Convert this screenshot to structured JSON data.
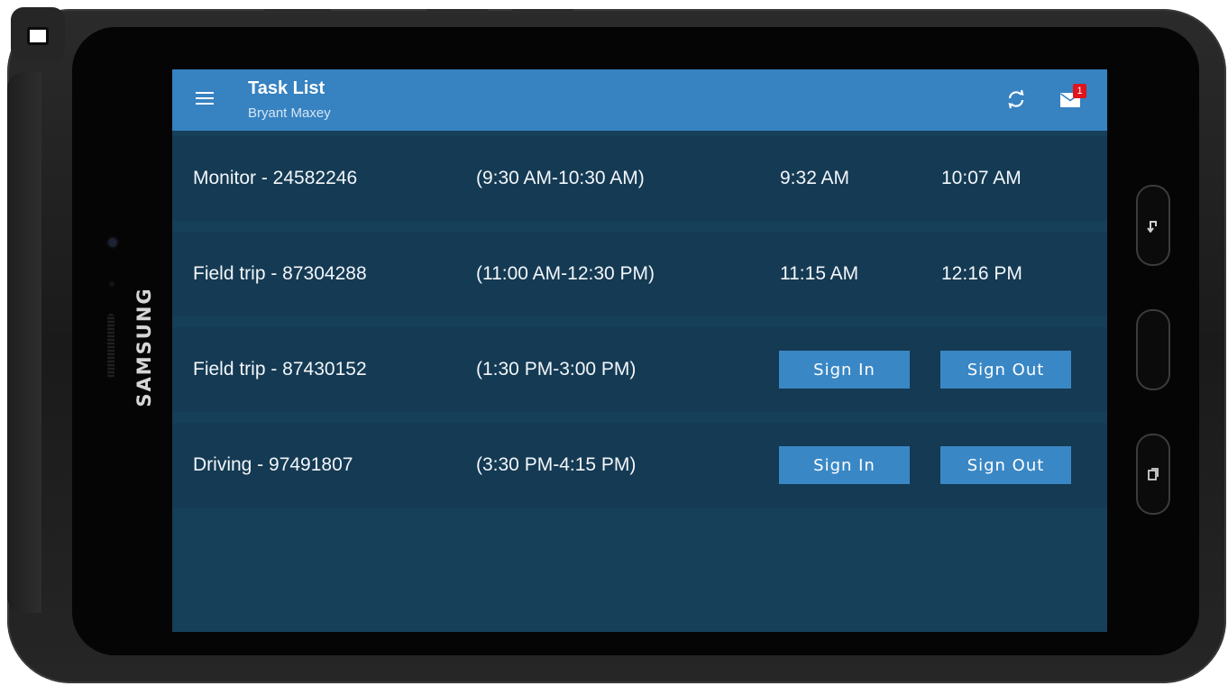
{
  "device": {
    "brand": "SAMSUNG"
  },
  "appbar": {
    "title": "Task List",
    "subtitle": "Bryant Maxey",
    "mail_badge_count": "1",
    "colors": {
      "appbar_bg": "#3782c1",
      "screen_bg": "#16405a",
      "button_bg": "#3a87c5",
      "badge_bg": "#e0141d"
    },
    "icons": [
      "menu-icon",
      "sync-icon",
      "mail-icon"
    ]
  },
  "tasks": [
    {
      "name": "Monitor - 24582246",
      "window": "(9:30 AM-10:30 AM)",
      "sign_in": "9:32 AM",
      "sign_out": "10:07 AM"
    },
    {
      "name": "Field trip - 87304288",
      "window": "(11:00 AM-12:30 PM)",
      "sign_in": "11:15 AM",
      "sign_out": "12:16 PM"
    },
    {
      "name": "Field trip - 87430152",
      "window": "(1:30 PM-3:00 PM)",
      "sign_in_button": "Sign In",
      "sign_out_button": "Sign Out"
    },
    {
      "name": "Driving - 97491807",
      "window": "(3:30 PM-4:15 PM)",
      "sign_in_button": "Sign In",
      "sign_out_button": "Sign Out"
    }
  ]
}
